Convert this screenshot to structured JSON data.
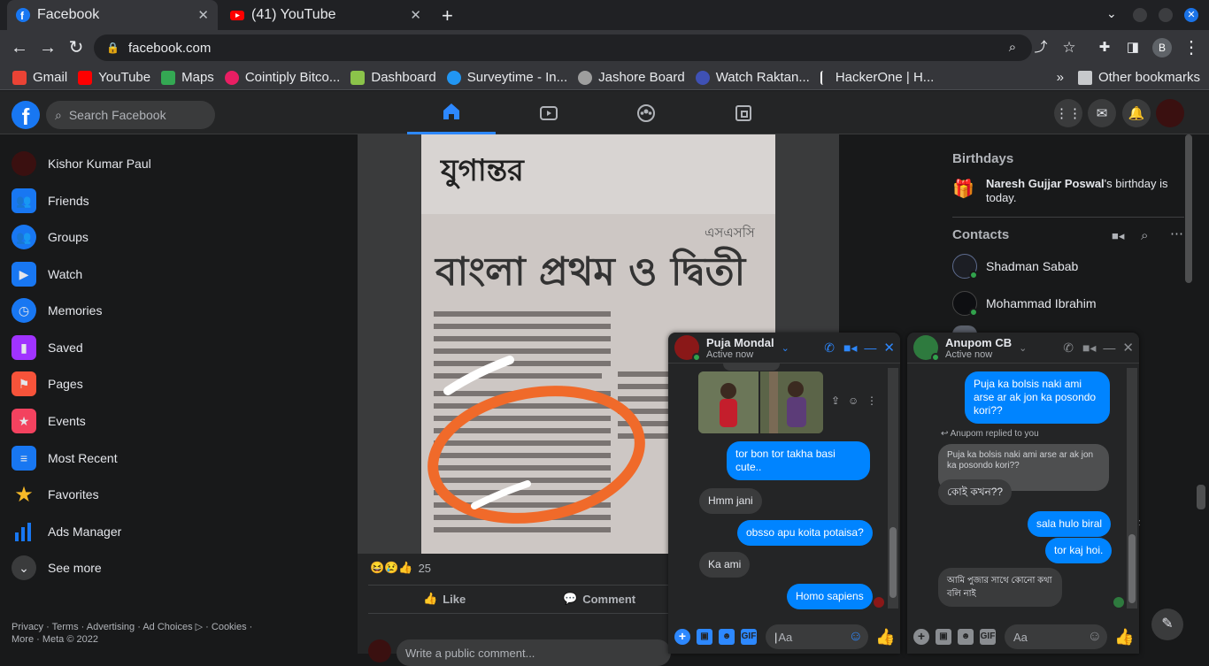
{
  "browser": {
    "tabs": [
      {
        "title": "Facebook",
        "active": true
      },
      {
        "title": "(41) YouTube",
        "active": false
      }
    ],
    "new_tab": "+",
    "url": "facebook.com",
    "profile_initial": "B",
    "bookmarks": [
      {
        "label": "Gmail",
        "color": "#ea4335"
      },
      {
        "label": "YouTube",
        "color": "#ff0000"
      },
      {
        "label": "Maps",
        "color": "#34a853"
      },
      {
        "label": "Cointiply Bitco...",
        "color": "#e91e63"
      },
      {
        "label": "Dashboard",
        "color": "#8bc34a"
      },
      {
        "label": "Surveytime - In...",
        "color": "#2196f3"
      },
      {
        "label": "Jashore Board",
        "color": "#9e9e9e"
      },
      {
        "label": "Watch Raktan...",
        "color": "#3f51b5"
      },
      {
        "label": "HackerOne | H...",
        "color": "#ffffff"
      }
    ],
    "overflow": "»",
    "other_bookmarks": "Other bookmarks"
  },
  "fb": {
    "logo": "f",
    "search_placeholder": "Search Facebook",
    "sidebar": [
      {
        "label": "Kishor Kumar Paul",
        "icon": "avatar",
        "color": "#3a1010"
      },
      {
        "label": "Friends",
        "icon": "friends-icon",
        "color": "#1877f2"
      },
      {
        "label": "Groups",
        "icon": "groups-icon",
        "color": "#1877f2"
      },
      {
        "label": "Watch",
        "icon": "watch-icon",
        "color": "#1877f2"
      },
      {
        "label": "Memories",
        "icon": "memories-icon",
        "color": "#1877f2"
      },
      {
        "label": "Saved",
        "icon": "saved-icon",
        "color": "#a033ff"
      },
      {
        "label": "Pages",
        "icon": "pages-icon",
        "color": "#f7533a"
      },
      {
        "label": "Events",
        "icon": "events-icon",
        "color": "#f3425f"
      },
      {
        "label": "Most Recent",
        "icon": "most-recent-icon",
        "color": "#1877f2"
      },
      {
        "label": "Favorites",
        "icon": "favorites-icon",
        "color": "#f7b928"
      },
      {
        "label": "Ads Manager",
        "icon": "ads-manager-icon",
        "color": "#1877f2"
      },
      {
        "label": "See more",
        "icon": "chevron-down-icon",
        "color": "#3a3b3c"
      }
    ],
    "footer": "Privacy · Terms · Advertising · Ad Choices ▷ · Cookies · More · Meta © 2022",
    "post": {
      "reaction_count": "25",
      "like_label": "Like",
      "comment_label": "Comment",
      "comment_placeholder": "Write a public comment...",
      "newspaper_lines": [
        "যুগান্তর",
        "বাংলা প্রথম ও দ্বিতী",
        "এসএসসি"
      ]
    },
    "birthdays": {
      "heading": "Birthdays",
      "name": "Naresh Gujjar Poswal",
      "text": "'s birthday is today."
    },
    "contacts": {
      "heading": "Contacts",
      "items": [
        "Shadman Sabab",
        "Mohammad Ibrahim"
      ]
    },
    "chats": [
      {
        "name": "Puja Mondal",
        "status": "Active now",
        "input_placeholder": "Aa",
        "messages": [
          {
            "from": "me",
            "text": "tor bon tor takha basi cute.."
          },
          {
            "from": "them",
            "text": "Hmm   jani"
          },
          {
            "from": "me",
            "text": "obsso apu koita potaisa?"
          },
          {
            "from": "them",
            "text": "Ka   ami"
          },
          {
            "from": "me",
            "text": "Homo sapiens"
          }
        ]
      },
      {
        "name": "Anupom CB",
        "status": "Active now",
        "input_placeholder": "Aa",
        "reply_note": "Anupom replied to you",
        "messages": [
          {
            "from": "me",
            "text": "Puja ka bolsis naki ami arse ar ak jon ka posondo kori??"
          },
          {
            "from": "quote",
            "text": "Puja ka bolsis naki ami arse ar ak jon ka posondo kori??"
          },
          {
            "from": "them",
            "text": "কোই কখন??"
          },
          {
            "from": "me",
            "text": "sala hulo biral"
          },
          {
            "from": "me",
            "text": "tor kaj hoi."
          },
          {
            "from": "them",
            "text": "আমি পুজার সাথে কোনো কথা বলি নাই"
          }
        ]
      }
    ]
  }
}
